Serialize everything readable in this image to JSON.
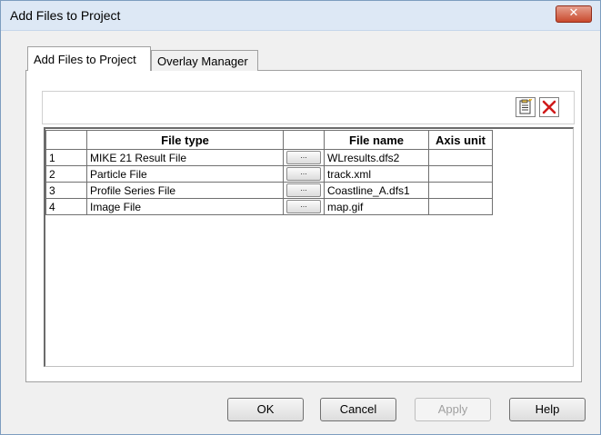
{
  "window": {
    "title": "Add Files to Project",
    "close_glyph": "✕"
  },
  "tabs": [
    {
      "label": "Add Files to Project",
      "active": true
    },
    {
      "label": "Overlay Manager",
      "active": false
    }
  ],
  "toolbar": {
    "add_icon": "paste-document-icon",
    "delete_icon": "red-x-delete-icon"
  },
  "grid": {
    "columns": [
      "",
      "File type",
      "",
      "File name",
      "Axis unit"
    ],
    "browse_label": "...",
    "rows": [
      {
        "index": "1",
        "file_type": "MIKE 21 Result File",
        "file_name": "WLresults.dfs2",
        "axis_unit": ""
      },
      {
        "index": "2",
        "file_type": "Particle File",
        "file_name": "track.xml",
        "axis_unit": ""
      },
      {
        "index": "3",
        "file_type": "Profile Series File",
        "file_name": "Coastline_A.dfs1",
        "axis_unit": ""
      },
      {
        "index": "4",
        "file_type": "Image File",
        "file_name": "map.gif",
        "axis_unit": ""
      }
    ]
  },
  "buttons": {
    "ok": "OK",
    "cancel": "Cancel",
    "apply": "Apply",
    "help": "Help"
  },
  "colors": {
    "close_button": "#c94a2e",
    "delete_icon": "#d01a1a"
  }
}
